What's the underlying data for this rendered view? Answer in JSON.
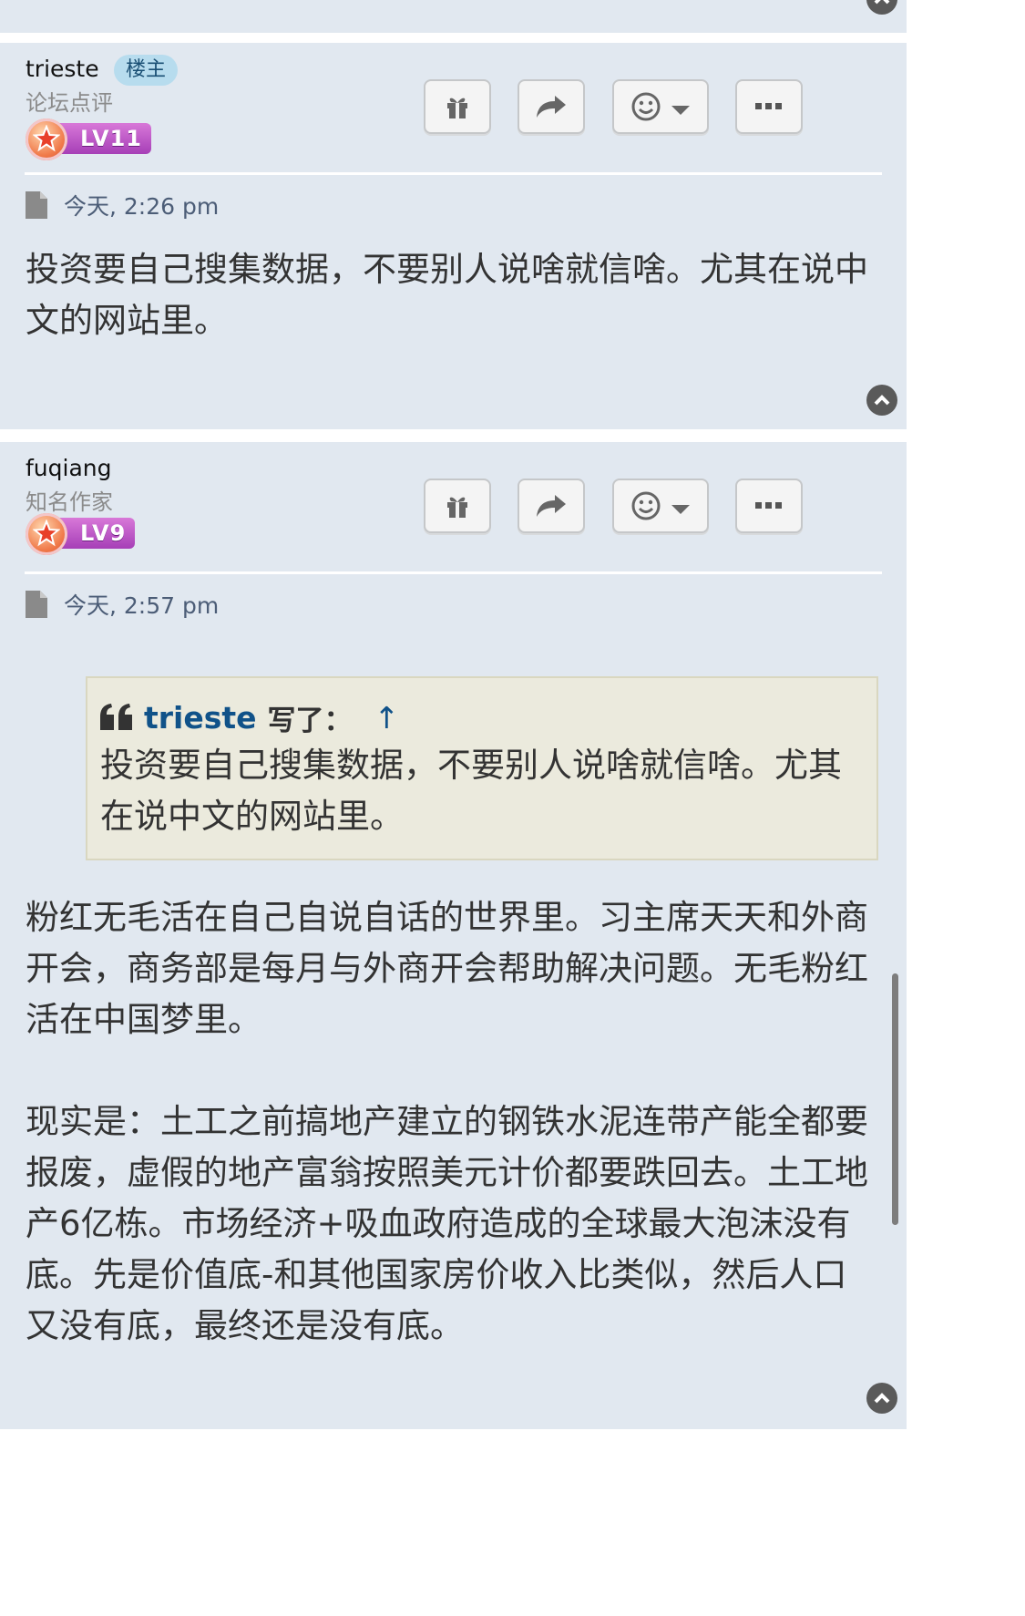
{
  "posts": [
    {
      "username": "trieste",
      "op_badge": "楼主",
      "rank": "论坛点评",
      "level": "LV11",
      "time": "今天, 2:26 pm",
      "content": [
        "投资要自己搜集数据，不要别人说啥就信啥。尤其在说中文的网站里。"
      ]
    },
    {
      "username": "fuqiang",
      "rank": "知名作家",
      "level": "LV9",
      "time": "今天, 2:57 pm",
      "quote": {
        "author": "trieste",
        "wrote": "写了：",
        "arrow": "↑",
        "text": "投资要自己搜集数据，不要别人说啥就信啥。尤其在说中文的网站里。"
      },
      "content": [
        "粉红无毛活在自己自说自话的世界里。习主席天天和外商开会，商务部是每月与外商开会帮助解决问题。无毛粉红活在中国梦里。",
        "现实是：土工之前搞地产建立的钢铁水泥连带产能全都要报废，虚假的地产富翁按照美元计价都要跌回去。土工地产6亿栋。市场经济+吸血政府造成的全球最大泡沫没有底。先是价值底-和其他国家房价收入比类似，然后人口又没有底，最终还是没有底。"
      ]
    }
  ],
  "icons": {
    "gift": "gift-icon",
    "share": "share-icon",
    "react": "smiley-icon",
    "more": "ellipsis-icon",
    "post": "document-icon",
    "top": "chevron-up-icon",
    "quote": "quote-icon"
  },
  "colors": {
    "post_bg": "#e1e8f0",
    "op_badge_bg": "#b7dcee",
    "link": "#105289",
    "quote_bg": "#ebeadd"
  }
}
